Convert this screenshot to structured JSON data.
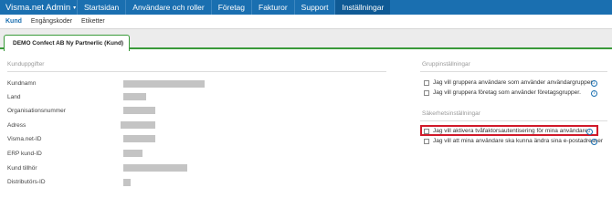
{
  "topnav": {
    "brand": "Visma.net Admin",
    "items": [
      "Startsidan",
      "Användare och roller",
      "Företag",
      "Fakturor",
      "Support",
      "Inställningar"
    ]
  },
  "subnav": {
    "items": [
      "Kund",
      "Engångskoder",
      "Etiketter"
    ]
  },
  "tab": {
    "label": "DEMO Confect AB Ny Partnerlic (Kund)"
  },
  "customer": {
    "title": "Kunduppgifter",
    "fields": [
      "Kundnamn",
      "Land",
      "Organisationsnummer",
      "Adress",
      "Visma.net-ID",
      "ERP kund-ID",
      "Kund tillhör",
      "Distributörs-ID"
    ]
  },
  "group_settings": {
    "title": "Gruppinställningar",
    "items": [
      "Jag vill gruppera användare som använder användargrupper.",
      "Jag vill gruppera företag som använder företagsgrupper."
    ]
  },
  "security_settings": {
    "title": "Säkerhetsinställningar",
    "items": [
      "Jag vill aktivera tvåfaktorsautentisering för mina användare.",
      "Jag vill att mina användare ska kunna ändra sina e-postadresser"
    ]
  },
  "colors": {
    "topbar": "#1a6fb0",
    "tab_accent": "#3a9a3a",
    "highlight": "#d11a2a"
  }
}
